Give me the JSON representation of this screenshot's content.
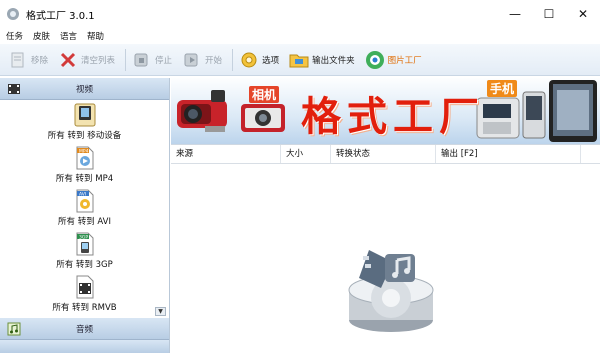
{
  "window": {
    "title": "格式工厂 3.0.1"
  },
  "menu": [
    "任务",
    "皮肤",
    "语言",
    "帮助"
  ],
  "toolbar": {
    "remove": "移除",
    "clear_list": "清空列表",
    "stop": "停止",
    "start": "开始",
    "options": "选项",
    "output_folder": "输出文件夹",
    "picture_factory": "图片工厂"
  },
  "sidebar": {
    "video_header": "视频",
    "items": [
      "所有 转到 移动设备",
      "所有 转到 MP4",
      "所有 转到 AVI",
      "所有 转到 3GP",
      "所有 转到 RMVB"
    ],
    "icon_tags": [
      "",
      "MP4",
      "AVI",
      "3GP",
      ""
    ],
    "audio_header": "音频"
  },
  "banner": {
    "title": "格式工厂",
    "camera_label": "相机",
    "phone_label": "手机"
  },
  "table": {
    "columns": [
      "来源",
      "大小",
      "转换状态",
      "输出 [F2]",
      ""
    ]
  }
}
